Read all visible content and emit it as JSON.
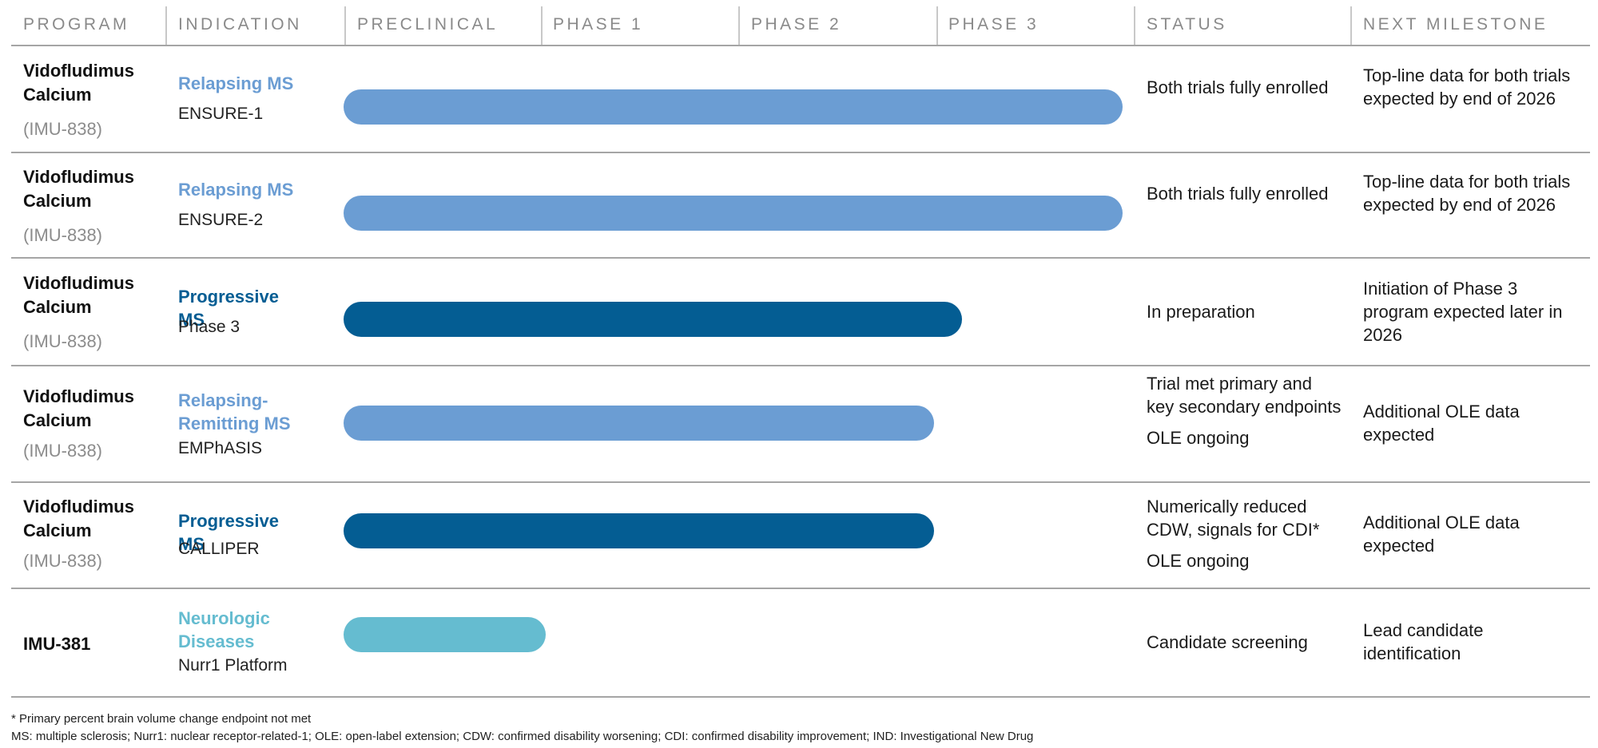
{
  "colors": {
    "light_blue": "#6b9dd3",
    "dark_blue": "#045d93",
    "teal": "#65bcd0",
    "header_text": "#8a8a8a",
    "code_gray": "#8c8c8c"
  },
  "headers": {
    "program": "PROGRAM",
    "indication": "INDICATION",
    "preclinical": "PRECLINICAL",
    "phase1": "PHASE 1",
    "phase2": "PHASE 2",
    "phase3": "PHASE 3",
    "status": "STATUS",
    "next_milestone": "NEXT MILESTONE"
  },
  "rows": [
    {
      "program_line1": "Vidofludimus",
      "program_line2": "Calcium",
      "program_code": "(IMU-838)",
      "indication": "Relapsing MS",
      "trial": "ENSURE-1",
      "status": "Both trials fully enrolled",
      "status_extra": "",
      "milestone": "Top-line data for both trials expected by end of 2026"
    },
    {
      "program_line1": "Vidofludimus",
      "program_line2": "Calcium",
      "program_code": "(IMU-838)",
      "indication": "Relapsing MS",
      "trial": "ENSURE-2",
      "status": "Both trials fully enrolled",
      "status_extra": "",
      "milestone": "Top-line data for both trials expected by end of 2026"
    },
    {
      "program_line1": "Vidofludimus",
      "program_line2": "Calcium",
      "program_code": "(IMU-838)",
      "indication": "Progressive MS",
      "trial": "Phase 3",
      "status": "In preparation",
      "status_extra": "",
      "milestone": "Initiation of Phase 3 program expected later in 2026"
    },
    {
      "program_line1": "Vidofludimus",
      "program_line2": "Calcium",
      "program_code": "(IMU-838)",
      "indication": "Relapsing-Remitting MS",
      "trial": "EMPhASIS",
      "status": "Trial met primary and key secondary endpoints",
      "status_extra": "OLE ongoing",
      "milestone": "Additional OLE data expected"
    },
    {
      "program_line1": "Vidofludimus",
      "program_line2": "Calcium",
      "program_code": "(IMU-838)",
      "indication": "Progressive MS",
      "trial": "CALLIPER",
      "status": "Numerically reduced CDW, signals for CDI*",
      "status_extra": "OLE ongoing",
      "milestone": "Additional OLE data expected"
    },
    {
      "program_line1": "IMU-381",
      "program_line2": "",
      "program_code": "",
      "indication": "Neurologic Diseases",
      "trial": "Nurr1 Platform",
      "status": "Candidate screening",
      "status_extra": "",
      "milestone": "Lead candidate identification"
    }
  ],
  "chart_data": {
    "type": "bar",
    "orientation": "horizontal",
    "stages": [
      "PRECLINICAL",
      "PHASE 1",
      "PHASE 2",
      "PHASE 3"
    ],
    "bars": [
      {
        "trial": "ENSURE-1",
        "progress": 3.93,
        "color": "#6b9dd3"
      },
      {
        "trial": "ENSURE-2",
        "progress": 3.93,
        "color": "#6b9dd3"
      },
      {
        "trial": "Phase 3",
        "progress": 3.12,
        "color": "#045d93"
      },
      {
        "trial": "EMPhASIS",
        "progress": 2.98,
        "color": "#6b9dd3"
      },
      {
        "trial": "CALLIPER",
        "progress": 2.98,
        "color": "#045d93"
      },
      {
        "trial": "Nurr1 Platform",
        "progress": 1.02,
        "color": "#65bcd0"
      }
    ]
  },
  "footnotes": {
    "asterisk": "*  Primary percent brain volume change endpoint not met",
    "abbreviations": "MS: multiple sclerosis; Nurr1: nuclear receptor-related-1; OLE: open-label extension; CDW: confirmed disability worsening; CDI: confirmed disability improvement; IND: Investigational New Drug"
  }
}
